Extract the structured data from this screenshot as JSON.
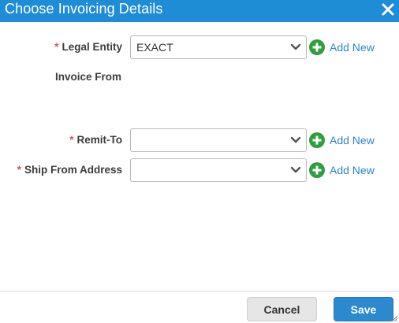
{
  "dialog": {
    "title": "Choose Invoicing Details",
    "close_icon": "close-icon"
  },
  "form": {
    "required_marker": "*",
    "legal_entity": {
      "label": "Legal Entity",
      "value": "EXACT",
      "add_new": "Add New"
    },
    "invoice_from": {
      "label": "Invoice From"
    },
    "remit_to": {
      "label": "Remit-To",
      "value": "",
      "add_new": "Add New"
    },
    "ship_from": {
      "label": "Ship From Address",
      "value": "",
      "add_new": "Add New"
    }
  },
  "footer": {
    "cancel_label": "Cancel",
    "save_label": "Save"
  },
  "colors": {
    "title_bar": "#1f8dd6",
    "link": "#2a86c7",
    "add_icon": "#2e9e3e",
    "required": "#d9534f",
    "save_button": "#2b89cf"
  }
}
